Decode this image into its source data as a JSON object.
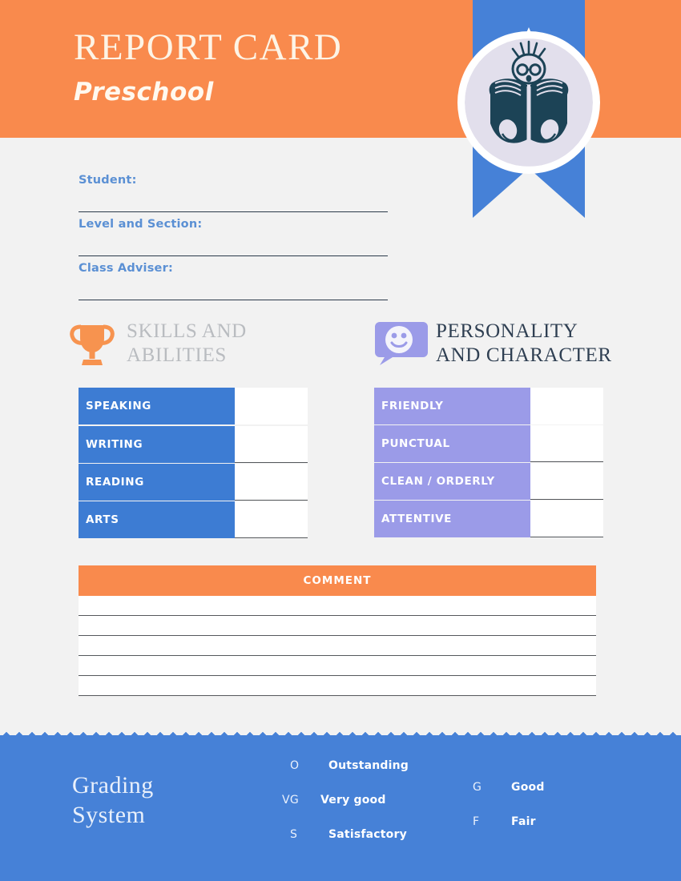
{
  "header": {
    "title": "REPORT CARD",
    "subtitle": "Preschool",
    "badge_icon": "child-reading-book-icon",
    "ribbon_icon": "ribbon-banner",
    "colors": {
      "orange": "#f98a4d",
      "blue": "#4681d7",
      "title_cream": "#fdf4e6"
    }
  },
  "fields": [
    {
      "label": "Student:",
      "value": ""
    },
    {
      "label": "Level and Section:",
      "value": ""
    },
    {
      "label": "Class Adviser:",
      "value": ""
    }
  ],
  "sections": {
    "skills": {
      "icon": "trophy-icon",
      "title_line1": "SKILLS AND",
      "title_line2": "ABILITIES",
      "accent": "#3d7cd3",
      "rows": [
        {
          "label": "SPEAKING",
          "value": ""
        },
        {
          "label": "WRITING",
          "value": ""
        },
        {
          "label": "READING",
          "value": ""
        },
        {
          "label": "ARTS",
          "value": ""
        }
      ]
    },
    "personality": {
      "icon": "smiley-speech-bubble-icon",
      "title_line1": "PERSONALITY",
      "title_line2": "AND CHARACTER",
      "accent": "#9b9be8",
      "rows": [
        {
          "label": "FRIENDLY",
          "value": ""
        },
        {
          "label": "PUNCTUAL",
          "value": ""
        },
        {
          "label": "CLEAN / ORDERLY",
          "value": ""
        },
        {
          "label": "ATTENTIVE",
          "value": ""
        }
      ]
    }
  },
  "comment": {
    "header": "COMMENT",
    "accent": "#f98a4d",
    "lines": [
      "",
      "",
      "",
      "",
      ""
    ]
  },
  "footer": {
    "title_line1": "Grading",
    "title_line2": "System",
    "accent": "#4681d7",
    "scale_left": [
      {
        "code": "O",
        "name": "Outstanding"
      },
      {
        "code": "VG",
        "name": "Very good"
      },
      {
        "code": "S",
        "name": "Satisfactory"
      }
    ],
    "scale_right": [
      {
        "code": "G",
        "name": "Good"
      },
      {
        "code": "F",
        "name": "Fair"
      }
    ]
  }
}
